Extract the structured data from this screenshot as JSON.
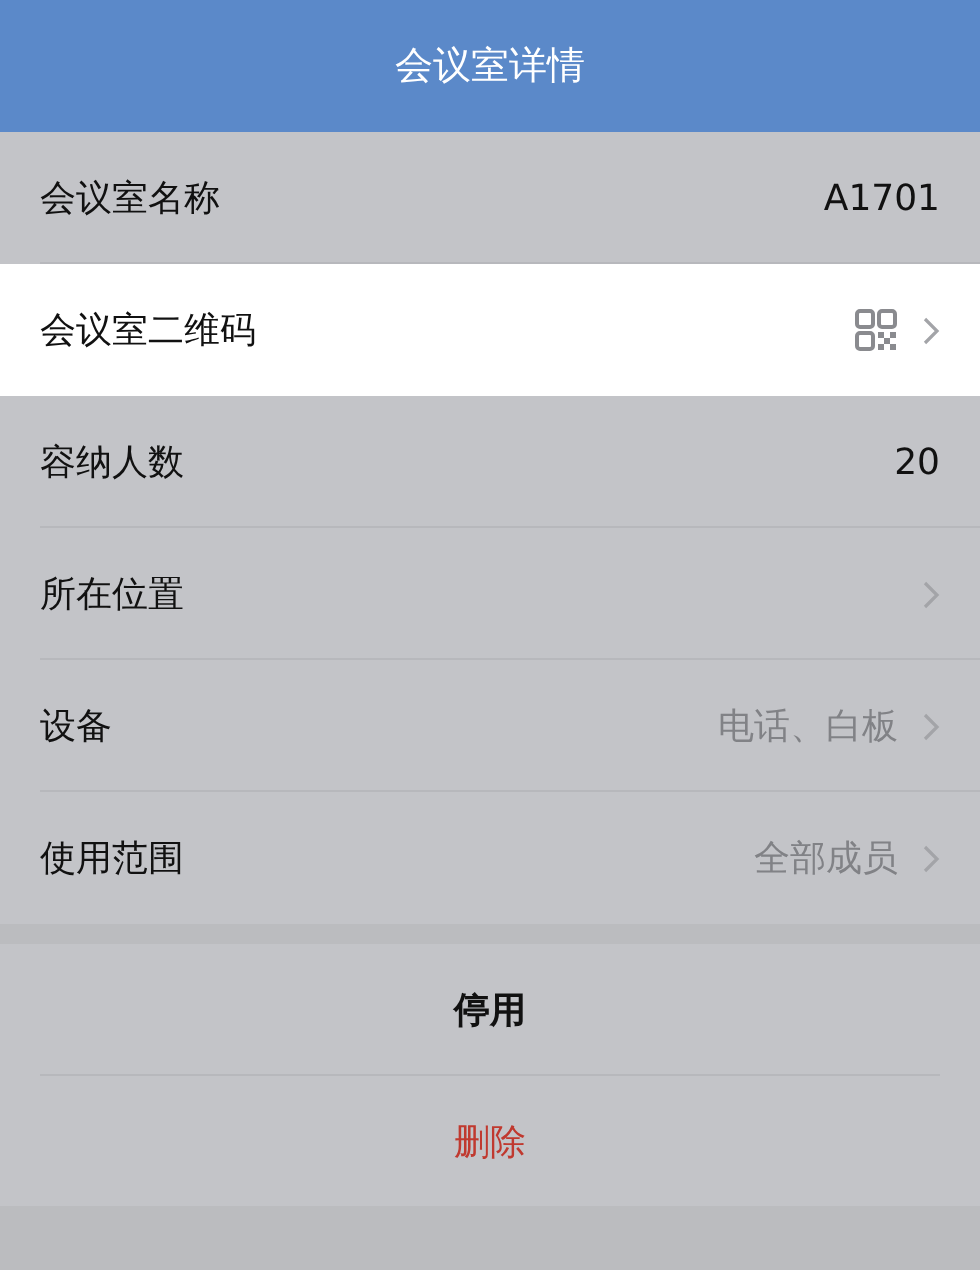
{
  "header": {
    "title": "会议室详情"
  },
  "rows": [
    {
      "label": "会议室名称",
      "value": "A1701",
      "kind": "text",
      "chevron": false,
      "selected": false
    },
    {
      "label": "会议室二维码",
      "kind": "qr",
      "chevron": true,
      "selected": true
    },
    {
      "label": "容纳人数",
      "value": "20",
      "kind": "text",
      "chevron": false,
      "selected": false
    },
    {
      "label": "所在位置",
      "kind": "text",
      "chevron": true,
      "selected": false
    },
    {
      "label": "设备",
      "value": "电话、白板",
      "kind": "text",
      "chevron": true,
      "selected": false
    },
    {
      "label": "使用范围",
      "value": "全部成员",
      "kind": "text",
      "chevron": true,
      "selected": false
    }
  ],
  "actions": [
    {
      "label": "停用",
      "kind": "normal"
    },
    {
      "label": "删除",
      "kind": "danger"
    }
  ]
}
